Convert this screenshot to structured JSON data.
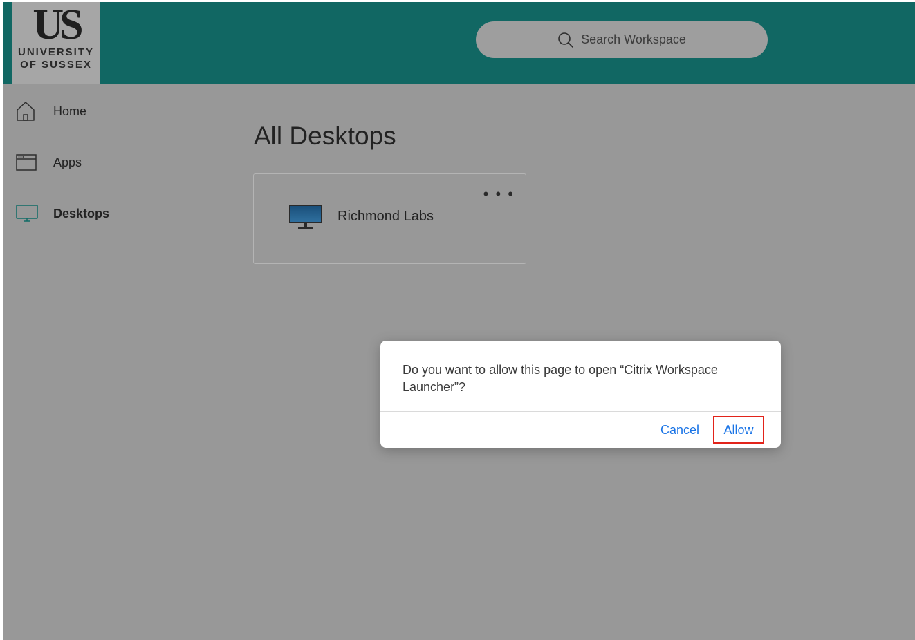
{
  "header": {
    "logo": {
      "mark": "US",
      "line1": "UNIVERSITY",
      "line2": "OF SUSSEX"
    },
    "search": {
      "placeholder": "Search Workspace",
      "icon": "search-icon"
    }
  },
  "sidebar": {
    "items": [
      {
        "label": "Home",
        "icon": "home-icon",
        "active": false
      },
      {
        "label": "Apps",
        "icon": "apps-icon",
        "active": false
      },
      {
        "label": "Desktops",
        "icon": "desktop-icon",
        "active": true
      }
    ]
  },
  "main": {
    "title": "All Desktops",
    "cards": [
      {
        "label": "Richmond Labs",
        "menu": "• • •",
        "icon": "monitor-icon"
      }
    ]
  },
  "dialog": {
    "message": "Do you want to allow this page to open “Citrix Workspace Launcher”?",
    "cancel_label": "Cancel",
    "allow_label": "Allow"
  },
  "colors": {
    "header_bg": "#116763",
    "overlay_bg": "#989898",
    "link_blue": "#1a74e6",
    "highlight_red": "#e2231a"
  }
}
